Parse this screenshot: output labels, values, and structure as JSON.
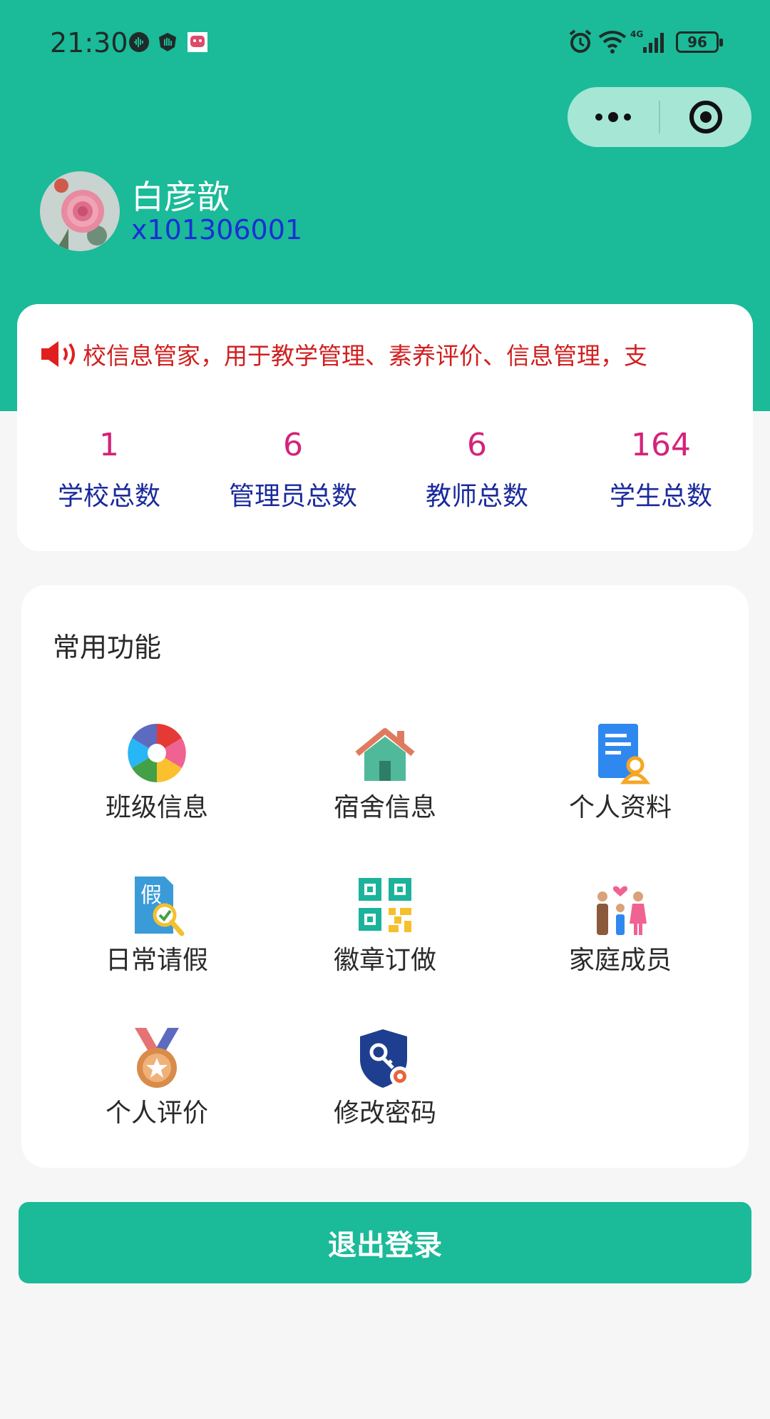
{
  "status_bar": {
    "time": "21:30",
    "battery": "96"
  },
  "user": {
    "name": "白彦歆",
    "id": "x101306001"
  },
  "notice": {
    "text": "校信息管家，用于教学管理、素养评价、信息管理，支"
  },
  "stats": [
    {
      "value": "1",
      "label": "学校总数"
    },
    {
      "value": "6",
      "label": "管理员总数"
    },
    {
      "value": "6",
      "label": "教师总数"
    },
    {
      "value": "164",
      "label": "学生总数"
    }
  ],
  "functions": {
    "title": "常用功能",
    "items": [
      {
        "label": "班级信息",
        "icon": "aperture-icon"
      },
      {
        "label": "宿舍信息",
        "icon": "house-icon"
      },
      {
        "label": "个人资料",
        "icon": "profile-document-icon"
      },
      {
        "label": "日常请假",
        "icon": "leave-document-icon"
      },
      {
        "label": "徽章订做",
        "icon": "qr-code-icon"
      },
      {
        "label": "家庭成员",
        "icon": "family-icon"
      },
      {
        "label": "个人评价",
        "icon": "medal-icon"
      },
      {
        "label": "修改密码",
        "icon": "key-shield-icon"
      }
    ]
  },
  "logout_label": "退出登录",
  "colors": {
    "primary": "#1bba98",
    "stat_value": "#d4237a",
    "stat_label": "#1a2a9c",
    "notice_text": "#d11f1f",
    "user_id": "#1b2fd6"
  }
}
